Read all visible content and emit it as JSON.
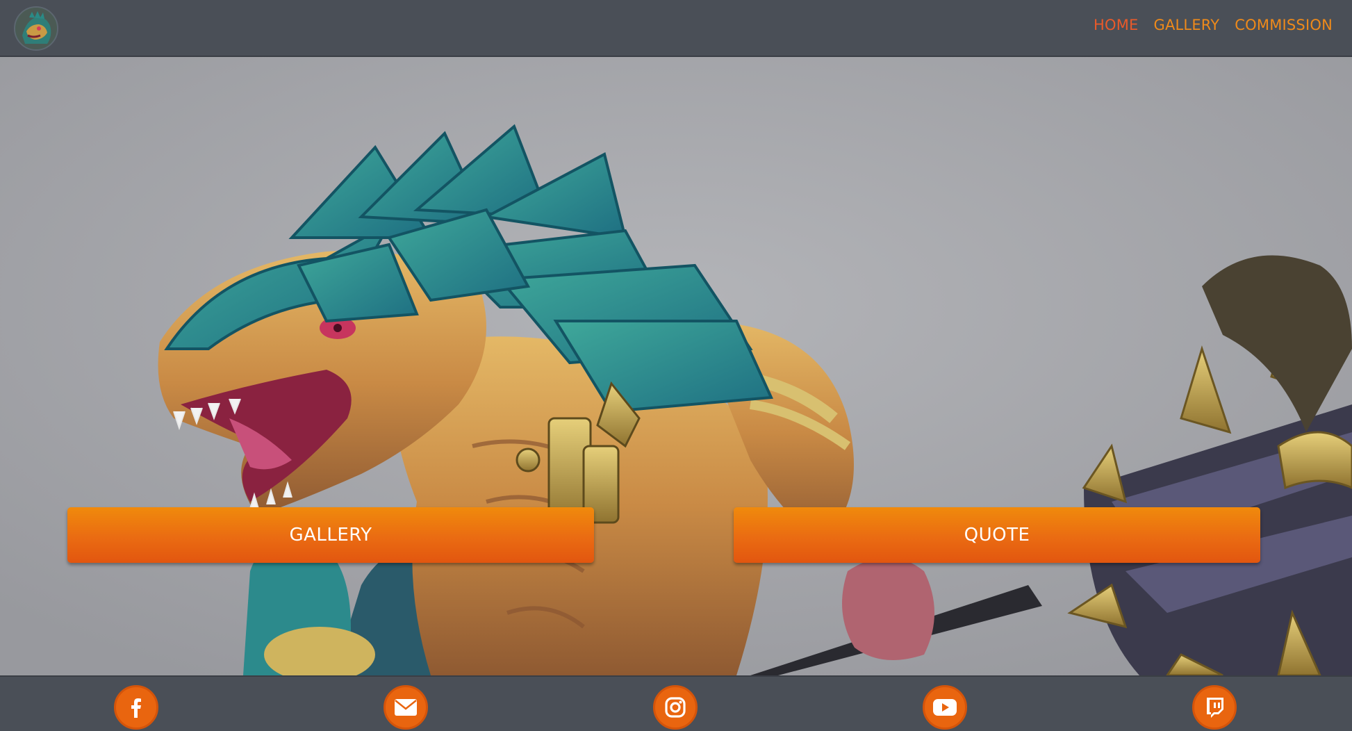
{
  "header": {
    "logo_icon": "lizardman-avatar-logo",
    "nav": [
      {
        "label": "HOME",
        "active": true
      },
      {
        "label": "GALLERY",
        "active": false
      },
      {
        "label": "COMMISSION",
        "active": false
      }
    ]
  },
  "hero": {
    "image_subject": "painted-lizardman-miniature-with-spiked-mace",
    "buttons": {
      "gallery_label": "GALLERY",
      "quote_label": "QUOTE"
    }
  },
  "footer": {
    "social": [
      {
        "icon": "facebook-icon"
      },
      {
        "icon": "email-icon"
      },
      {
        "icon": "instagram-icon"
      },
      {
        "icon": "youtube-icon"
      },
      {
        "icon": "twitch-icon"
      }
    ]
  },
  "colors": {
    "header_bg": "#4a4f57",
    "nav_text": "#ef8a1a",
    "nav_active": "#ea5a2a",
    "button_orange": "#ea6b12",
    "social_orange": "#e9650f"
  }
}
